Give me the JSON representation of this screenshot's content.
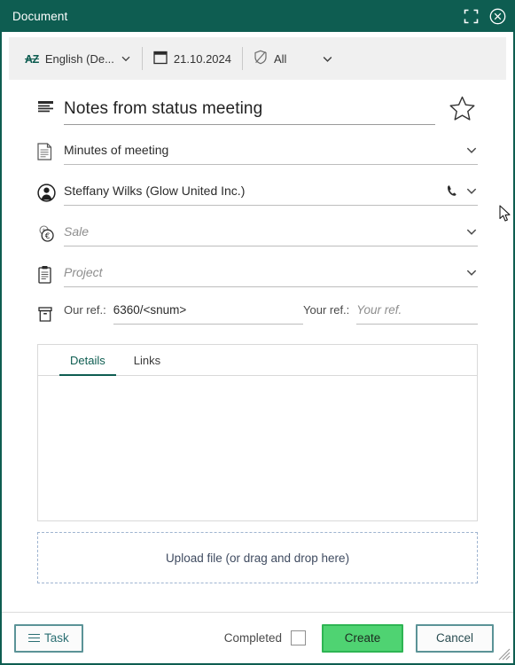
{
  "window": {
    "title": "Document",
    "accent_color": "#0e5d51",
    "actions": [
      {
        "name": "expand-icon",
        "label": "Expand"
      },
      {
        "name": "close-icon",
        "label": "Close"
      }
    ]
  },
  "toolbar": {
    "language": {
      "icon": "sort-alpha-icon",
      "value": "English (De...",
      "has_caret": true
    },
    "date": {
      "icon": "calendar-icon",
      "value": "21.10.2024"
    },
    "visibility": {
      "icon": "shield-slash-icon",
      "value": "All",
      "has_caret": true
    }
  },
  "form": {
    "title_field": {
      "icon": "lines-icon",
      "value": "Notes from status meeting"
    },
    "favorite": {
      "icon": "star-icon",
      "active": false
    },
    "type_field": {
      "icon": "document-icon",
      "value": "Minutes of meeting",
      "is_placeholder": false
    },
    "contact_field": {
      "icon": "person-icon",
      "value": "Steffany Wilks (Glow United Inc.)",
      "is_placeholder": false,
      "phone_icon": "phone-icon"
    },
    "sale_field": {
      "icon": "currency-icon",
      "value": "Sale",
      "is_placeholder": true
    },
    "project_field": {
      "icon": "clipboard-icon",
      "value": "Project",
      "is_placeholder": true
    },
    "refs": {
      "icon": "archive-icon",
      "our_ref": {
        "label": "Our ref.:",
        "value": "6360/<snum>",
        "is_placeholder": false
      },
      "your_ref": {
        "label": "Your ref.:",
        "value": "Your ref.",
        "is_placeholder": true
      }
    }
  },
  "tabs": {
    "items": [
      {
        "label": "Details",
        "active": true
      },
      {
        "label": "Links",
        "active": false
      }
    ]
  },
  "dropzone": {
    "label": "Upload file (or drag and drop here)"
  },
  "footer": {
    "task_button": {
      "label": "Task",
      "icon": "hamburger-icon"
    },
    "completed": {
      "label": "Completed",
      "checked": false
    },
    "create_button": {
      "label": "Create",
      "color": "#4fd372"
    },
    "cancel_button": {
      "label": "Cancel"
    }
  }
}
